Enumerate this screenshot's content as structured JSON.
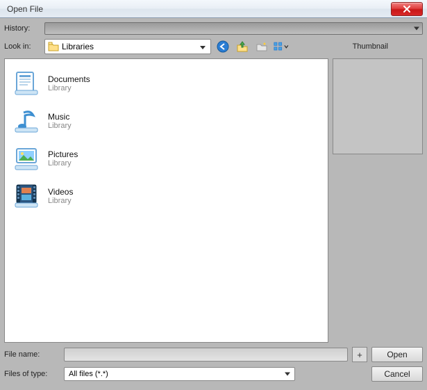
{
  "window": {
    "title": "Open File"
  },
  "history": {
    "label": "History:"
  },
  "lookin": {
    "label": "Look in:",
    "value": "Libraries"
  },
  "thumbnail_label": "Thumbnail",
  "items": [
    {
      "name": "Documents",
      "sub": "Library",
      "icon": "doc"
    },
    {
      "name": "Music",
      "sub": "Library",
      "icon": "music"
    },
    {
      "name": "Pictures",
      "sub": "Library",
      "icon": "pic"
    },
    {
      "name": "Videos",
      "sub": "Library",
      "icon": "vid"
    }
  ],
  "filename": {
    "label": "File name:",
    "value": ""
  },
  "filetype": {
    "label": "Files of type:",
    "value": "All files (*.*)"
  },
  "buttons": {
    "plus": "+",
    "open": "Open",
    "cancel": "Cancel"
  }
}
